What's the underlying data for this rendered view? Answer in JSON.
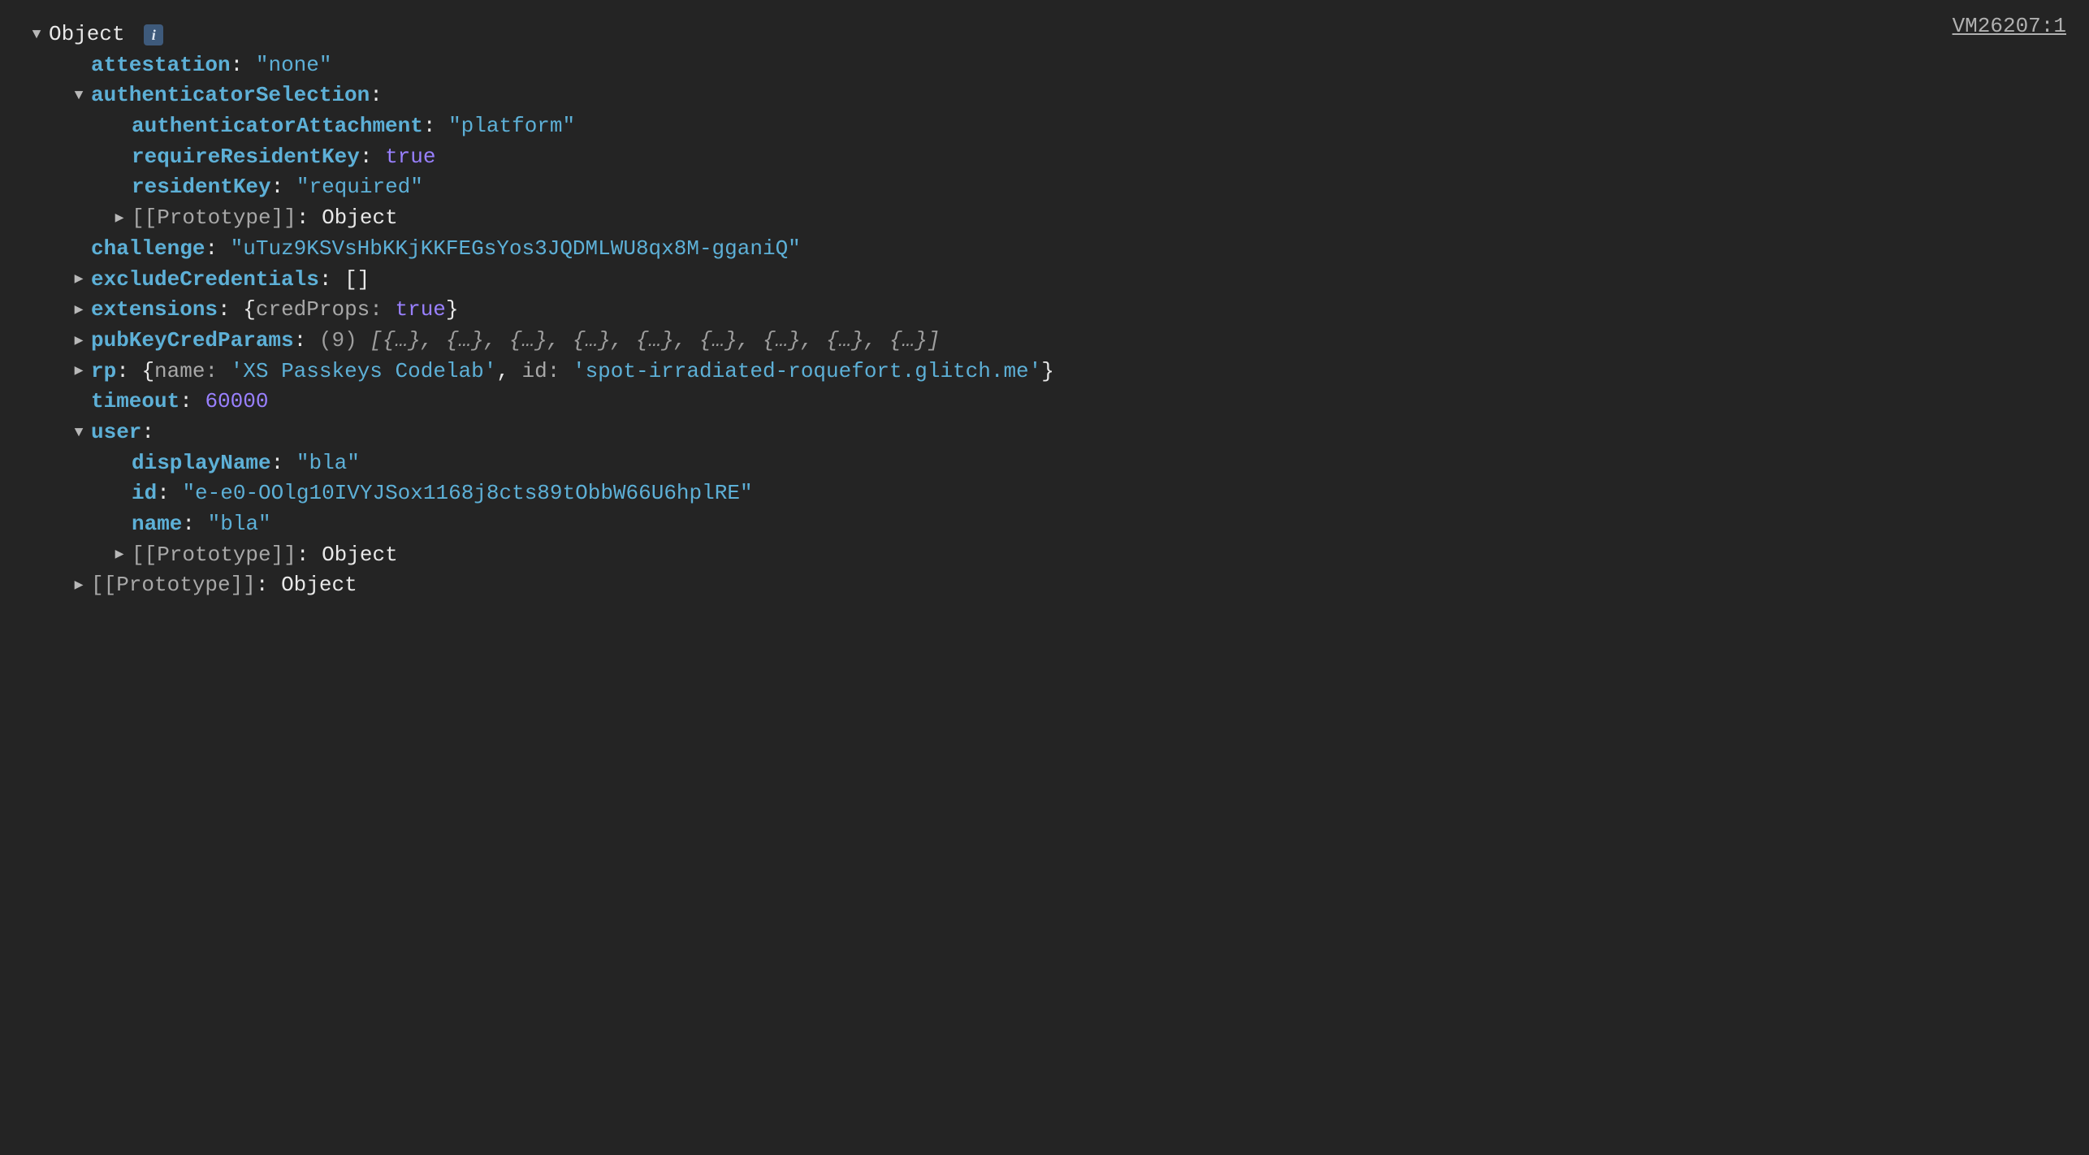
{
  "source": {
    "label": "VM26207:1"
  },
  "root": {
    "label": "Object",
    "info": "i"
  },
  "props": {
    "attestation": {
      "key": "attestation",
      "value": "\"none\""
    },
    "authenticatorSelection": {
      "key": "authenticatorSelection",
      "authenticatorAttachment": {
        "key": "authenticatorAttachment",
        "value": "\"platform\""
      },
      "requireResidentKey": {
        "key": "requireResidentKey",
        "value": "true"
      },
      "residentKey": {
        "key": "residentKey",
        "value": "\"required\""
      },
      "prototype": {
        "key": "[[Prototype]]",
        "value": "Object"
      }
    },
    "challenge": {
      "key": "challenge",
      "value": "\"uTuz9KSVsHbKKjKKFEGsYos3JQDMLWU8qx8M-gganiQ\""
    },
    "excludeCredentials": {
      "key": "excludeCredentials",
      "value": "[]"
    },
    "extensions": {
      "key": "extensions",
      "summary_open": "{",
      "credProps_key": "credProps: ",
      "credProps_val": "true",
      "summary_close": "}"
    },
    "pubKeyCredParams": {
      "key": "pubKeyCredParams",
      "count": "(9) ",
      "summary": "[{…}, {…}, {…}, {…}, {…}, {…}, {…}, {…}, {…}]"
    },
    "rp": {
      "key": "rp",
      "open": "{",
      "name_key": "name: ",
      "name_val": "'XS Passkeys Codelab'",
      "sep": ", ",
      "id_key": "id: ",
      "id_val": "'spot-irradiated-roquefort.glitch.me'",
      "close": "}"
    },
    "timeout": {
      "key": "timeout",
      "value": "60000"
    },
    "user": {
      "key": "user",
      "displayName": {
        "key": "displayName",
        "value": "\"bla\""
      },
      "id": {
        "key": "id",
        "value": "\"e-e0-OOlg10IVYJSox1168j8cts89tObbW66U6hplRE\""
      },
      "name": {
        "key": "name",
        "value": "\"bla\""
      },
      "prototype": {
        "key": "[[Prototype]]",
        "value": "Object"
      }
    },
    "prototype": {
      "key": "[[Prototype]]",
      "value": "Object"
    }
  }
}
